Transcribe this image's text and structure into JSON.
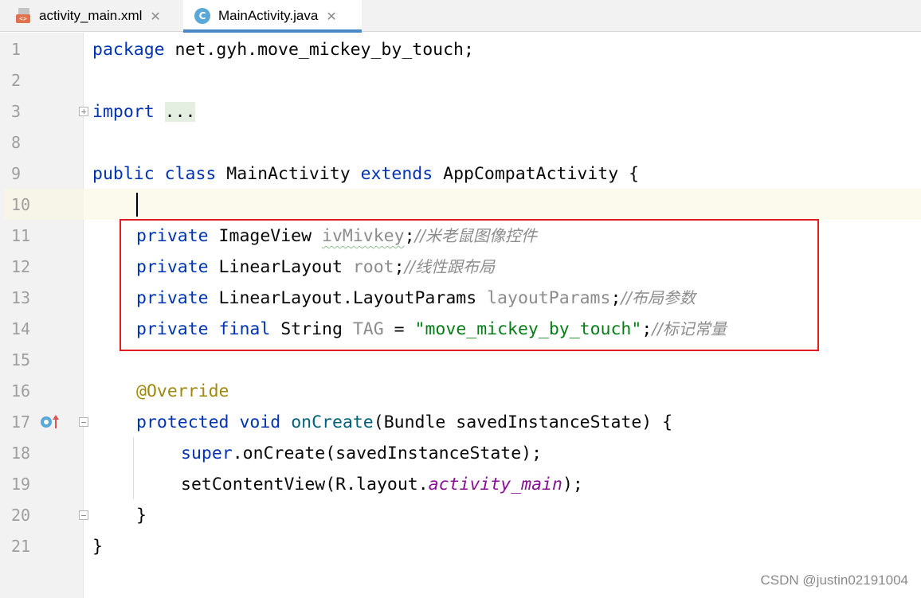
{
  "tabs": [
    {
      "label": "activity_main.xml",
      "icon": "xml-file-icon",
      "active": false
    },
    {
      "label": "MainActivity.java",
      "icon": "java-class-icon",
      "active": true
    }
  ],
  "line_numbers": [
    "1",
    "2",
    "3",
    "8",
    "9",
    "10",
    "11",
    "12",
    "13",
    "14",
    "15",
    "16",
    "17",
    "18",
    "19",
    "20",
    "21"
  ],
  "code": {
    "l1": {
      "kw": "package",
      "rest": " net.gyh.move_mickey_by_touch;"
    },
    "l3": {
      "kw": "import",
      "folded": "..."
    },
    "l9": {
      "kw1": "public",
      "kw2": "class",
      "name": " MainActivity ",
      "kw3": "extends",
      "rest": " AppCompatActivity {"
    },
    "l11": {
      "kw": "private",
      "type": " ImageView ",
      "field": "ivMivkey",
      "semi": ";",
      "comment": "//米老鼠图像控件"
    },
    "l12": {
      "kw": "private",
      "type": " LinearLayout ",
      "field": "root",
      "semi": ";",
      "comment": "//线性跟布局"
    },
    "l13": {
      "kw": "private",
      "type": " LinearLayout.LayoutParams ",
      "field": "layoutParams",
      "semi": ";",
      "comment": "//布局参数"
    },
    "l14": {
      "kw1": "private",
      "kw2": "final",
      "type": " String ",
      "field": "TAG",
      "eq": " = ",
      "str": "\"move_mickey_by_touch\"",
      "semi": ";",
      "comment": "//标记常量"
    },
    "l16": {
      "ann": "@Override"
    },
    "l17": {
      "kw1": "protected",
      "kw2": "void",
      "method": "onCreate",
      "rest": "(Bundle savedInstanceState) {"
    },
    "l18": {
      "kw": "super",
      "rest": ".onCreate(savedInstanceState);"
    },
    "l19": {
      "pre": "setContentView(R.layout.",
      "static": "activity_main",
      "post": ");"
    },
    "l20": {
      "text": "}"
    },
    "l21": {
      "text": "}"
    }
  },
  "colors": {
    "keyword": "#0033b3",
    "string": "#067d17",
    "annotation": "#9e880d",
    "highlight_box": "#e31b23",
    "active_tab_underline": "#4a88c7"
  },
  "watermark": "CSDN @justin02191004"
}
